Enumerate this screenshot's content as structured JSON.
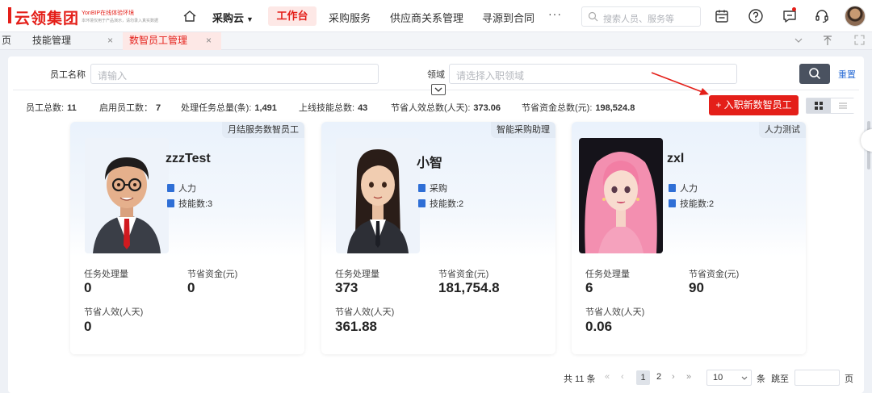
{
  "brand": {
    "logo_text": "云领集团",
    "logo_sub1": "YonBIP在线体验环境",
    "logo_sub2": "本环境仅用于产品演示，请勿录入真实数据"
  },
  "topnav": {
    "cloud_menu": "采购云",
    "items": [
      "工作台",
      "采购服务",
      "供应商关系管理",
      "寻源到合同"
    ],
    "more": "···",
    "search_placeholder": "搜索人员、服务等",
    "accent_color": "#e41f19"
  },
  "tabs": {
    "items": [
      {
        "label": "页"
      },
      {
        "label": "技能管理"
      },
      {
        "label": "数智员工管理"
      }
    ],
    "close_glyph": "×"
  },
  "filters": {
    "name_label": "员工名称",
    "name_placeholder": "请输入",
    "domain_label": "领域",
    "domain_placeholder": "请选择入职领域",
    "reset_label": "重置"
  },
  "stats": [
    {
      "label": "员工总数:",
      "value": "11"
    },
    {
      "label": "启用员工数：",
      "value": "7"
    },
    {
      "label": "处理任务总量(条):",
      "value": "1,491"
    },
    {
      "label": "上线技能总数:",
      "value": "43"
    },
    {
      "label": "节省人效总数(人天):",
      "value": "373.06"
    },
    {
      "label": "节省资金总数(元):",
      "value": "198,524.8"
    }
  ],
  "onboard_button": "+ 入职新数智员工",
  "metric_labels": {
    "tasks": "任务处理量",
    "savings": "节省资金(元)",
    "effort": "节省人效(人天)"
  },
  "cards": [
    {
      "tag": "月结服务数智员工",
      "name": "zzzTest",
      "domain": "人力",
      "skills": "技能数:3",
      "tasks": "0",
      "savings": "0",
      "effort": "0"
    },
    {
      "tag": "智能采购助理",
      "name": "小智",
      "domain": "采购",
      "skills": "技能数:2",
      "tasks": "373",
      "savings": "181,754.8",
      "effort": "361.88"
    },
    {
      "tag": "人力测试",
      "name": "zxl",
      "domain": "人力",
      "skills": "技能数:2",
      "tasks": "6",
      "savings": "90",
      "effort": "0.06"
    }
  ],
  "pagination": {
    "total": "共 11 条",
    "pages": [
      "1",
      "2"
    ],
    "current": "1",
    "page_size": "10",
    "unit": "条",
    "jump_label": "跳至",
    "page_suffix": "页"
  }
}
